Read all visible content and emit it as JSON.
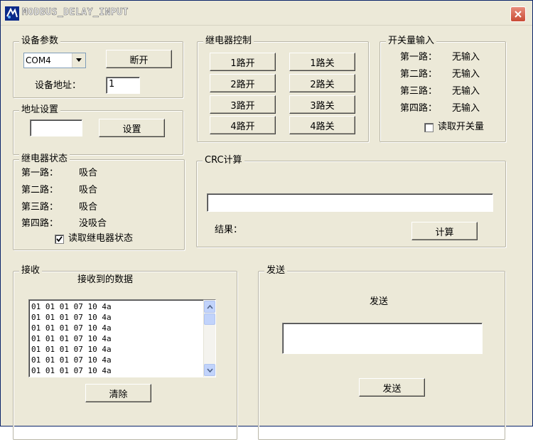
{
  "window": {
    "title": "MODBUS_DELAY_INPUT"
  },
  "device": {
    "group_label": "设备参数",
    "port_value": "COM4",
    "disconnect_label": "断开",
    "address_label": "设备地址：",
    "address_value": "1"
  },
  "address_setting": {
    "group_label": "地址设置",
    "input_value": "",
    "set_label": "设置"
  },
  "relay_control": {
    "group_label": "继电器控制",
    "buttons": [
      {
        "on": "1路开",
        "off": "1路关"
      },
      {
        "on": "2路开",
        "off": "2路关"
      },
      {
        "on": "3路开",
        "off": "3路关"
      },
      {
        "on": "4路开",
        "off": "4路关"
      }
    ]
  },
  "switch_input": {
    "group_label": "开关量输入",
    "rows": [
      {
        "label": "第一路：",
        "value": "无输入"
      },
      {
        "label": "第二路：",
        "value": "无输入"
      },
      {
        "label": "第三路：",
        "value": "无输入"
      },
      {
        "label": "第四路：",
        "value": "无输入"
      }
    ],
    "read_label": "读取开关量",
    "read_checked": false
  },
  "relay_status": {
    "group_label": "继电器状态",
    "rows": [
      {
        "label": "第一路：",
        "value": "吸合"
      },
      {
        "label": "第二路：",
        "value": "吸合"
      },
      {
        "label": "第三路：",
        "value": "吸合"
      },
      {
        "label": "第四路：",
        "value": "没吸合"
      }
    ],
    "read_label": "读取继电器状态",
    "read_checked": true
  },
  "crc": {
    "group_label": "CRC计算",
    "input_value": "",
    "result_label": "结果：",
    "calc_label": "计算"
  },
  "receive": {
    "group_label": "接收",
    "header": "接收到的数据",
    "lines": [
      "01 01 01 07 10 4a",
      "01 01 01 07 10 4a",
      "01 01 01 07 10 4a",
      "01 01 01 07 10 4a",
      "01 01 01 07 10 4a",
      "01 01 01 07 10 4a",
      "01 01 01 07 10 4a"
    ],
    "clear_label": "清除"
  },
  "send": {
    "group_label": "发送",
    "header": "发送",
    "input_value": "",
    "send_label": "发送"
  }
}
